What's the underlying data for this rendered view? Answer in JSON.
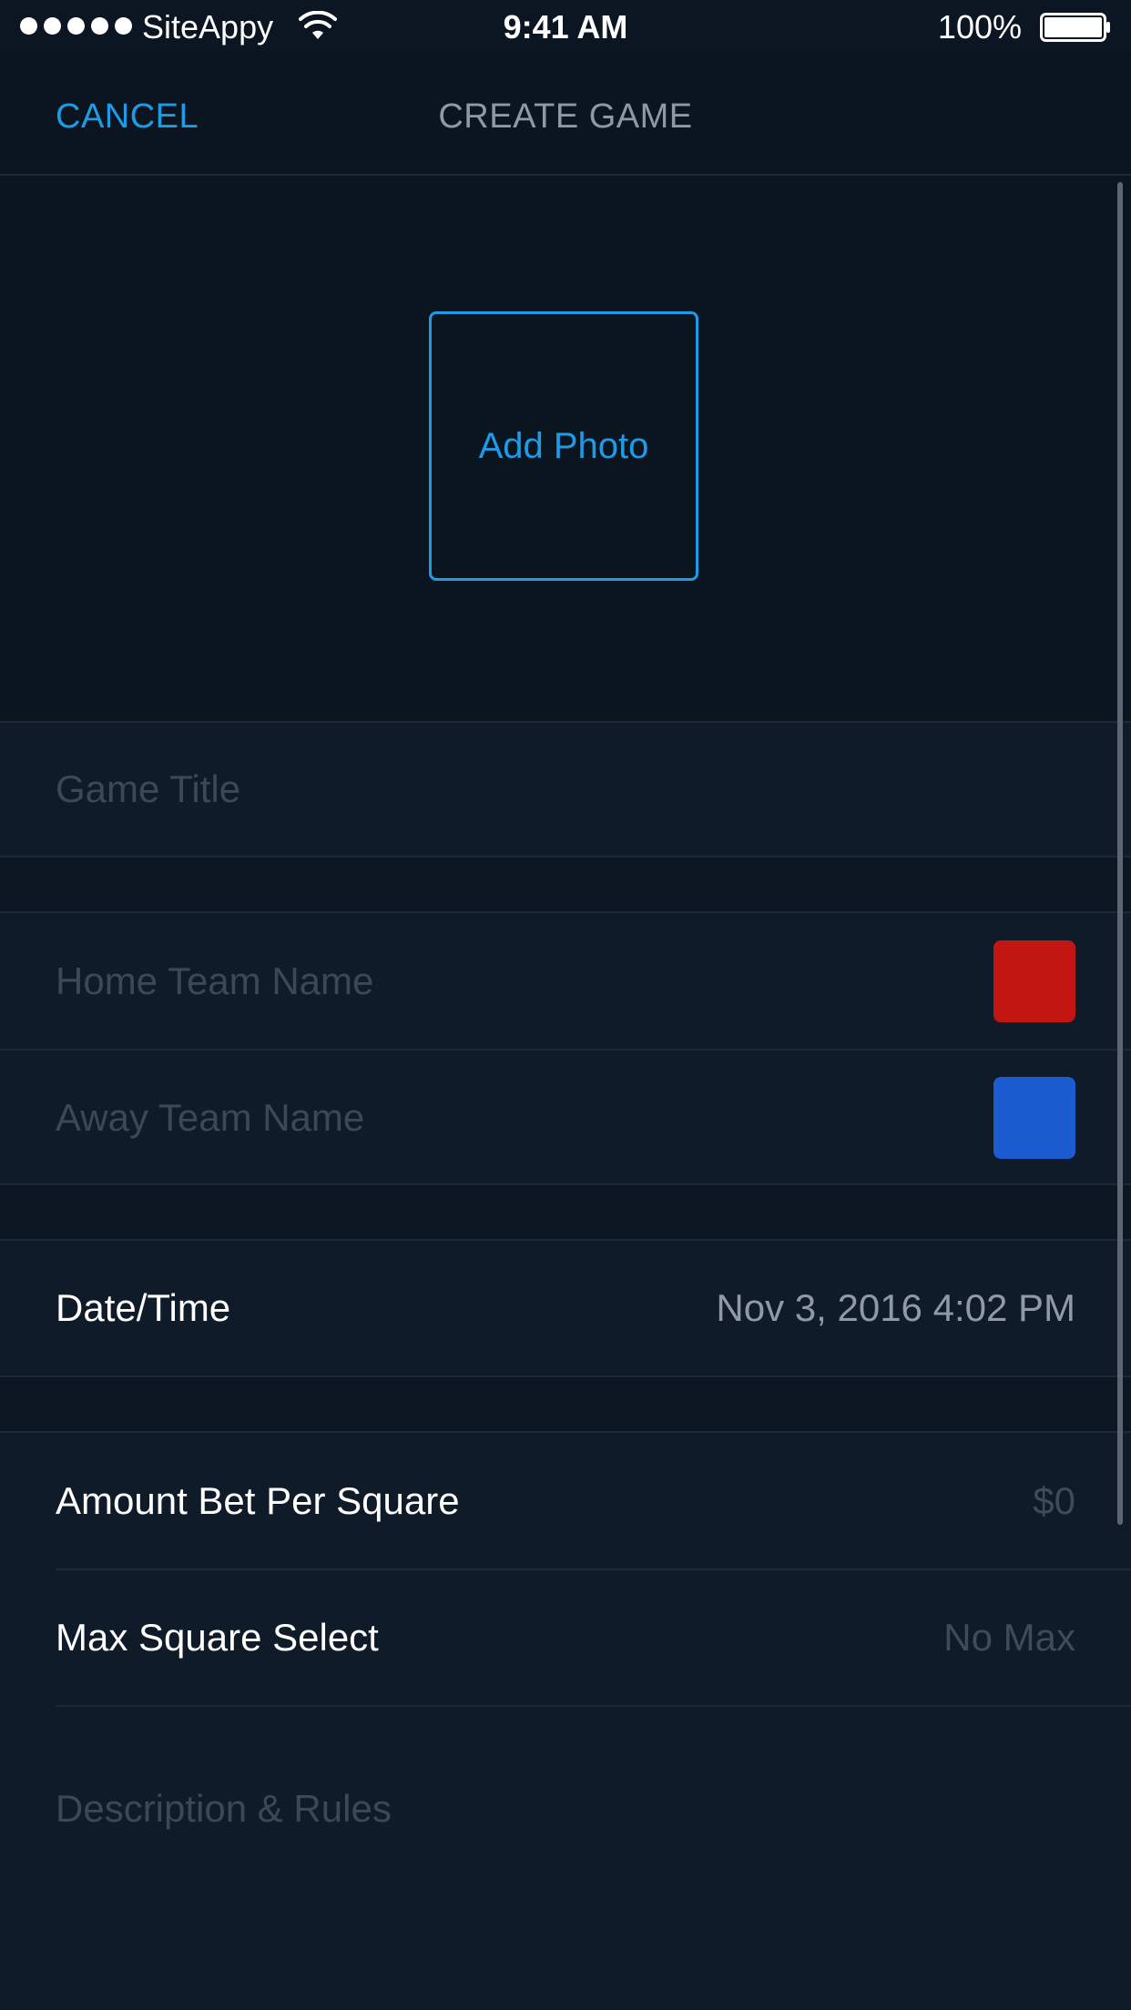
{
  "status_bar": {
    "carrier": "SiteAppy",
    "time": "9:41 AM",
    "battery": "100%",
    "signal_icon": "signal-dots-icon",
    "wifi_icon": "wifi-icon",
    "battery_icon": "battery-icon"
  },
  "nav": {
    "cancel_label": "CANCEL",
    "title": "CREATE GAME"
  },
  "photo": {
    "add_photo_label": "Add Photo"
  },
  "form": {
    "game_title_placeholder": "Game Title",
    "home_team_placeholder": "Home Team Name",
    "away_team_placeholder": "Away Team Name",
    "home_team_color": "#c21612",
    "away_team_color": "#1b5cd1",
    "datetime_label": "Date/Time",
    "datetime_value": "Nov 3, 2016 4:02 PM",
    "amount_label": "Amount Bet Per Square",
    "amount_value": "$0",
    "max_square_label": "Max Square Select",
    "max_square_value": "No Max",
    "description_placeholder": "Description & Rules"
  },
  "colors": {
    "accent": "#1e9be6",
    "background": "#0c1622",
    "section_background": "#0f1b28"
  }
}
